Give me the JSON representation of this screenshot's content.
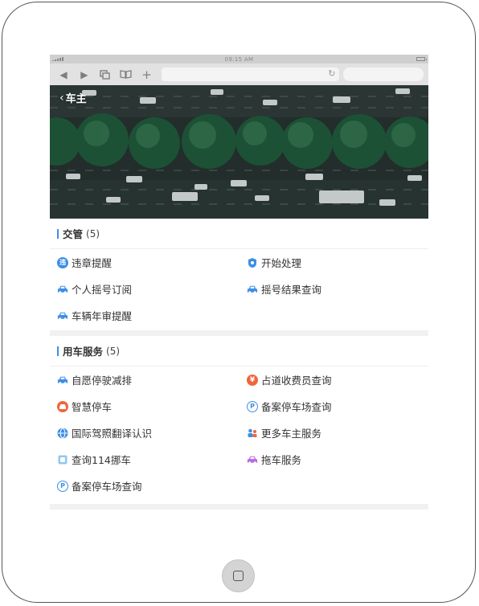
{
  "statusbar": {
    "time": "09:15 AM"
  },
  "header": {
    "back_label": "车主"
  },
  "sections": [
    {
      "title": "交管",
      "count": "(5)",
      "items": [
        {
          "label": "违章提醒",
          "icon": "violation-icon"
        },
        {
          "label": "开始处理",
          "icon": "process-icon"
        },
        {
          "label": "个人摇号订阅",
          "icon": "car-icon"
        },
        {
          "label": "摇号结果查询",
          "icon": "car-icon"
        },
        {
          "label": "车辆年审提醒",
          "icon": "car-icon"
        }
      ]
    },
    {
      "title": "用车服务",
      "count": "(5)",
      "items": [
        {
          "label": "自愿停驶减排",
          "icon": "car-icon"
        },
        {
          "label": "占道收费员查询",
          "icon": "yen-icon"
        },
        {
          "label": "智慧停车",
          "icon": "smart-parking-icon"
        },
        {
          "label": "备案停车场查询",
          "icon": "parking-icon"
        },
        {
          "label": "国际驾照翻译认识",
          "icon": "globe-icon"
        },
        {
          "label": "更多车主服务",
          "icon": "people-icon"
        },
        {
          "label": "查询114挪车",
          "icon": "phone-icon"
        },
        {
          "label": "拖车服务",
          "icon": "tow-car-icon"
        },
        {
          "label": "备案停车场查询",
          "icon": "parking-icon"
        }
      ]
    }
  ],
  "colors": {
    "accent": "#3d8fe6",
    "orange": "#f0663c",
    "purple": "#b86be0"
  }
}
